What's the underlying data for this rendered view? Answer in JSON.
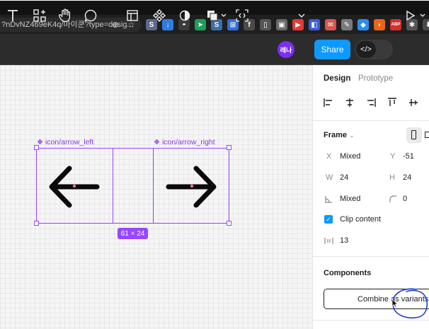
{
  "browser": {
    "url_fragment": "?nDvNZ469eK4q/마이쿤?type=desig...",
    "extensions": [
      {
        "label": "S",
        "color": "#5a6b8c"
      },
      {
        "label": "↓",
        "color": "#2f7de1"
      },
      {
        "label": "◓",
        "color": "#3a3a3a"
      },
      {
        "label": "➤",
        "color": "#1e9e5a"
      },
      {
        "label": "S",
        "color": "#3a6ea5"
      },
      {
        "label": "⊞",
        "color": "#2f6fd6"
      },
      {
        "label": "f",
        "color": "#4a4a4a"
      },
      {
        "label": "▯",
        "color": "#555555"
      },
      {
        "label": "▣",
        "color": "#6a6a6a"
      },
      {
        "label": "▶",
        "color": "#e53935"
      },
      {
        "label": "◧",
        "color": "#3b5bd6"
      },
      {
        "label": "✉",
        "color": "#d9534f"
      },
      {
        "label": "✎",
        "color": "#7a7a7a"
      },
      {
        "label": "◆",
        "color": "#2b8cf0"
      },
      {
        "label": "◗",
        "color": "#e8651a"
      },
      {
        "label": "ABP",
        "color": "#d32f2f"
      },
      {
        "label": "✱",
        "color": "#555555"
      },
      {
        "label": "⬇",
        "color": "#4a4a4a"
      },
      {
        "label": "▭",
        "color": "#4a4a4a"
      }
    ]
  },
  "toolbar": {
    "avatar_text": "레나",
    "share_label": "Share",
    "dev_mode_icon": "</>",
    "tool_icons": [
      "text-tool",
      "components-tool",
      "hand-tool",
      "comment-tool",
      "crop-tool",
      "component-tool",
      "contrast-tool",
      "boolean-tool",
      "dev-tool",
      "play-tool"
    ]
  },
  "canvas": {
    "left_label": "icon/arrow_left",
    "right_label": "icon/arrow_right",
    "dimensions": "61 × 24"
  },
  "panel": {
    "tabs": {
      "design": "Design",
      "prototype": "Prototype"
    },
    "frame": {
      "title": "Frame",
      "x_label": "X",
      "x_value": "Mixed",
      "y_label": "Y",
      "y_value": "-51",
      "w_label": "W",
      "w_value": "24",
      "h_label": "H",
      "h_value": "24",
      "rotation_value": "Mixed",
      "radius_value": "0",
      "clip_content": "Clip content",
      "gap_value": "13"
    },
    "components": {
      "title": "Components",
      "combine_label": "Combine as variants"
    }
  },
  "colors": {
    "accent": "#9747ff",
    "share": "#0d99ff",
    "annotation": "#1b3fd6"
  }
}
